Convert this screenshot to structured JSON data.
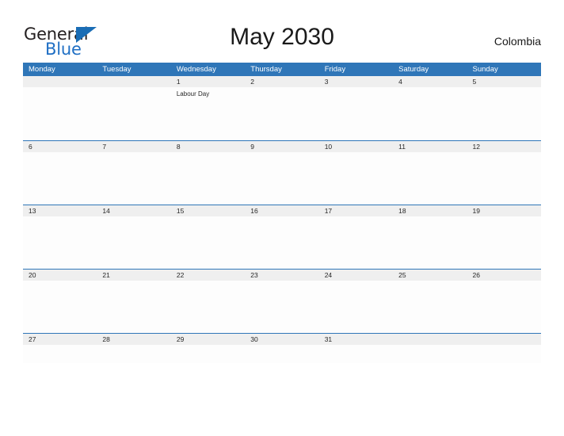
{
  "header": {
    "logo": {
      "text_top": "General",
      "text_bottom": "Blue",
      "triangle_icon": "blue-triangle-icon",
      "top_color": "#231f20",
      "bottom_color": "#1f6fc4",
      "triangle_color": "#1a6db5"
    },
    "title": "May 2030",
    "country": "Colombia"
  },
  "colors": {
    "header_band": "#2f76b8",
    "date_strip": "#efefef",
    "row_divider": "#2f76b8",
    "body": "#fdfdfd",
    "text": "#262626"
  },
  "calendar": {
    "weekdays": [
      "Monday",
      "Tuesday",
      "Wednesday",
      "Thursday",
      "Friday",
      "Saturday",
      "Sunday"
    ],
    "weeks": [
      {
        "days": [
          {
            "date": "",
            "event": ""
          },
          {
            "date": "",
            "event": ""
          },
          {
            "date": "1",
            "event": "Labour Day"
          },
          {
            "date": "2",
            "event": ""
          },
          {
            "date": "3",
            "event": ""
          },
          {
            "date": "4",
            "event": ""
          },
          {
            "date": "5",
            "event": ""
          }
        ]
      },
      {
        "days": [
          {
            "date": "6",
            "event": ""
          },
          {
            "date": "7",
            "event": ""
          },
          {
            "date": "8",
            "event": ""
          },
          {
            "date": "9",
            "event": ""
          },
          {
            "date": "10",
            "event": ""
          },
          {
            "date": "11",
            "event": ""
          },
          {
            "date": "12",
            "event": ""
          }
        ]
      },
      {
        "days": [
          {
            "date": "13",
            "event": ""
          },
          {
            "date": "14",
            "event": ""
          },
          {
            "date": "15",
            "event": ""
          },
          {
            "date": "16",
            "event": ""
          },
          {
            "date": "17",
            "event": ""
          },
          {
            "date": "18",
            "event": ""
          },
          {
            "date": "19",
            "event": ""
          }
        ]
      },
      {
        "days": [
          {
            "date": "20",
            "event": ""
          },
          {
            "date": "21",
            "event": ""
          },
          {
            "date": "22",
            "event": ""
          },
          {
            "date": "23",
            "event": ""
          },
          {
            "date": "24",
            "event": ""
          },
          {
            "date": "25",
            "event": ""
          },
          {
            "date": "26",
            "event": ""
          }
        ]
      },
      {
        "days": [
          {
            "date": "27",
            "event": ""
          },
          {
            "date": "28",
            "event": ""
          },
          {
            "date": "29",
            "event": ""
          },
          {
            "date": "30",
            "event": ""
          },
          {
            "date": "31",
            "event": ""
          },
          {
            "date": "",
            "event": ""
          },
          {
            "date": "",
            "event": ""
          }
        ]
      }
    ]
  }
}
